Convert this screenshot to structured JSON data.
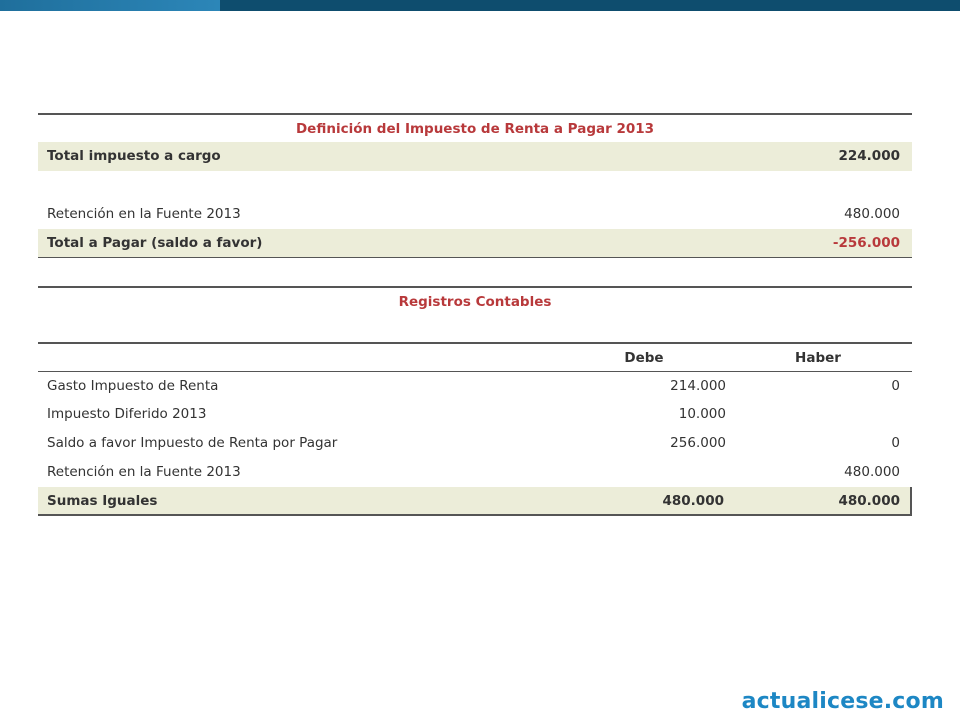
{
  "definicion": {
    "title": "Definición del Impuesto de Renta a Pagar 2013",
    "rows": [
      {
        "label": "Total impuesto a cargo",
        "value": "224.000"
      },
      {
        "label": "",
        "value": ""
      },
      {
        "label": "Retención en la Fuente  2013",
        "value": "480.000"
      },
      {
        "label": "Total a Pagar (saldo a favor)",
        "value": "-256.000"
      }
    ]
  },
  "registros": {
    "title": "Registros Contables",
    "col_debe": "Debe",
    "col_haber": "Haber",
    "rows": [
      {
        "label": "Gasto Impuesto de Renta",
        "debe": "214.000",
        "haber": "0"
      },
      {
        "label": "Impuesto Diferido 2013",
        "debe": "10.000",
        "haber": ""
      },
      {
        "label": "Saldo a favor Impuesto de Renta por Pagar",
        "debe": "256.000",
        "haber": "0"
      },
      {
        "label": "Retención en la Fuente 2013",
        "debe": "",
        "haber": "480.000"
      }
    ],
    "total": {
      "label": "Sumas Iguales",
      "debe": "480.000",
      "haber": "480.000"
    }
  },
  "brand": "actualicese.com",
  "colors": {
    "accent_red": "#b8393b",
    "shade": "#ecedd9",
    "brand_blue": "#1d87c4",
    "top_bar_dark": "#0e4d6e"
  }
}
